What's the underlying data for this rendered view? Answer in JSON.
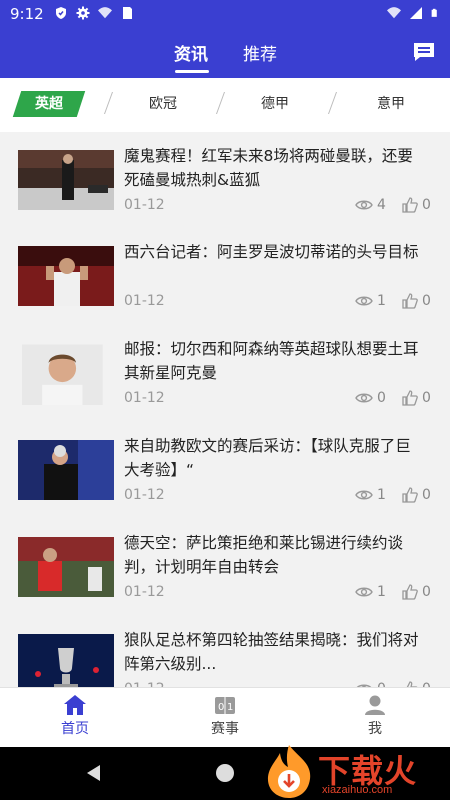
{
  "status_bar": {
    "time": "9:12"
  },
  "header": {
    "tabs": [
      {
        "label": "资讯",
        "active": true
      },
      {
        "label": "推荐",
        "active": false
      }
    ],
    "message_icon": "chat-bubble-icon",
    "color": "#3a3fd1"
  },
  "leagues": [
    {
      "label": "英超",
      "active": true
    },
    {
      "label": "欧冠",
      "active": false
    },
    {
      "label": "德甲",
      "active": false
    },
    {
      "label": "意甲",
      "active": false
    }
  ],
  "news": [
    {
      "title": "魔鬼赛程！红军未来8场将两碰曼联，还要死磕曼城热刺&蓝狐",
      "date": "01-12",
      "views": "4",
      "likes": "0"
    },
    {
      "title": "西六台记者：阿圭罗是波切蒂诺的头号目标",
      "date": "01-12",
      "views": "1",
      "likes": "0"
    },
    {
      "title": "邮报：切尔西和阿森纳等英超球队想要土耳其新星阿克曼",
      "date": "01-12",
      "views": "0",
      "likes": "0"
    },
    {
      "title": "来自助教欧文的赛后采访：【球队克服了巨大考验】“",
      "date": "01-12",
      "views": "1",
      "likes": "0"
    },
    {
      "title": "德天空：萨比策拒绝和莱比锡进行续约谈判，计划明年自由转会",
      "date": "01-12",
      "views": "1",
      "likes": "0"
    },
    {
      "title": "狼队足总杯第四轮抽签结果揭晓：我们将对阵第六级别...",
      "date": "01-12",
      "views": "0",
      "likes": "0"
    }
  ],
  "bottom_nav": [
    {
      "label": "首页",
      "icon": "home-icon",
      "active": true
    },
    {
      "label": "赛事",
      "icon": "scoreboard-icon",
      "active": false
    },
    {
      "label": "我",
      "icon": "person-icon",
      "active": false
    }
  ],
  "watermark": {
    "text": "下载火",
    "url": "xiazaihuo.com"
  }
}
